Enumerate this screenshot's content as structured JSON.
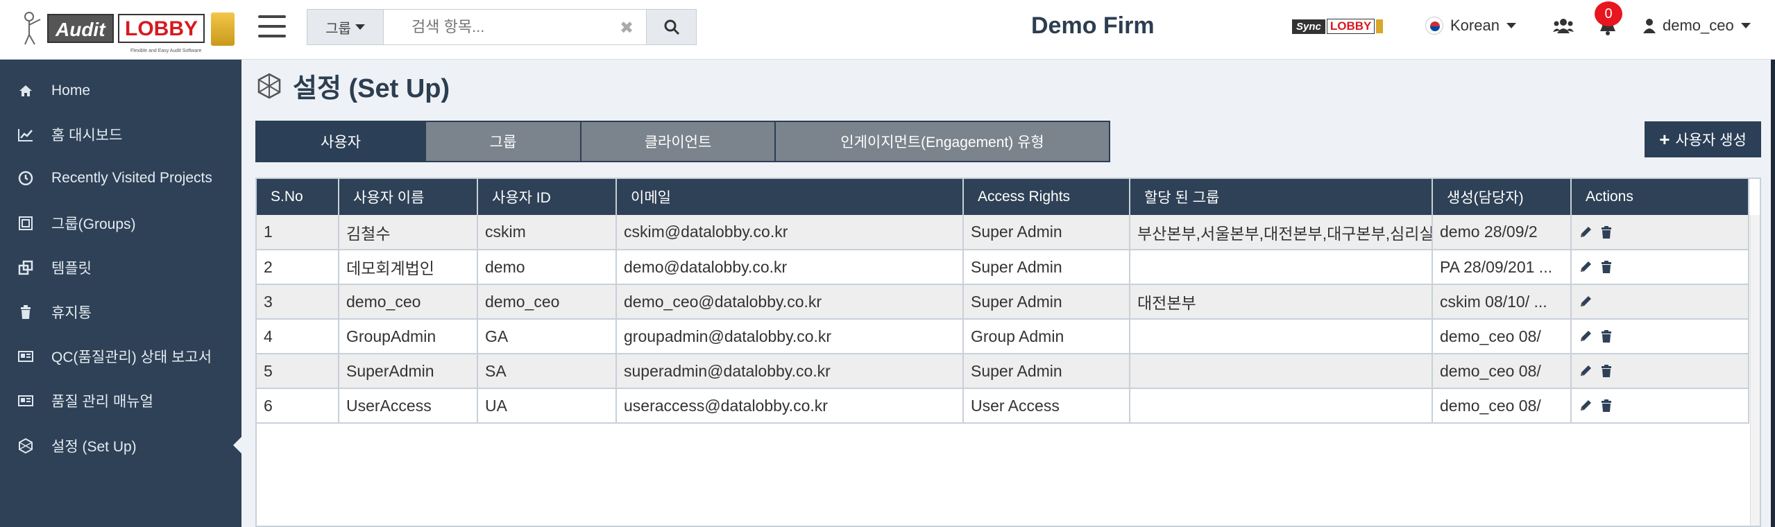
{
  "brand": {
    "logo_left": "Audit",
    "logo_right": "LOBBY",
    "tagline": "Flexible and Easy Audit Software",
    "sync_left": "Sync",
    "sync_right": "LOBBY"
  },
  "search": {
    "scope_label": "그룹",
    "placeholder": "검색 항목..."
  },
  "header": {
    "firm_name": "Demo Firm",
    "language": "Korean",
    "notification_count": "0",
    "username": "demo_ceo"
  },
  "sidebar": {
    "items": [
      {
        "label": "Home",
        "icon": "home-icon"
      },
      {
        "label": "홈 대시보드",
        "icon": "line-chart-icon"
      },
      {
        "label": "Recently Visited Projects",
        "icon": "clock-icon"
      },
      {
        "label": "그룹(Groups)",
        "icon": "groups-icon"
      },
      {
        "label": "템플릿",
        "icon": "template-icon"
      },
      {
        "label": "휴지통",
        "icon": "trash-icon"
      },
      {
        "label": "QC(품질관리) 상태 보고서",
        "icon": "report-icon"
      },
      {
        "label": "품질 관리 매뉴얼",
        "icon": "manual-icon"
      },
      {
        "label": "설정 (Set Up)",
        "icon": "setup-icon"
      }
    ]
  },
  "page": {
    "title": "설정 (Set Up)"
  },
  "tabs": [
    {
      "label": "사용자"
    },
    {
      "label": "그룹"
    },
    {
      "label": "클라이언트"
    },
    {
      "label": "인게이지먼트(Engagement) 유형"
    }
  ],
  "actions": {
    "create_user": "사용자 생성"
  },
  "table": {
    "headers": [
      "S.No",
      "사용자 이름",
      "사용자 ID",
      "이메일",
      "Access Rights",
      "할당 된 그룹",
      "생성(담당자)",
      "Actions"
    ],
    "rows": [
      {
        "sno": "1",
        "name": "김철수",
        "id": "cskim",
        "email": "cskim@datalobby.co.kr",
        "rights": "Super Admin",
        "groups": "부산본부,서울본부,대전본부,대구본부,심리실",
        "created": "demo 28/09/2",
        "delete": true
      },
      {
        "sno": "2",
        "name": "데모회계법인",
        "id": "demo",
        "email": "demo@datalobby.co.kr",
        "rights": "Super Admin",
        "groups": "",
        "created": "PA 28/09/201 ...",
        "delete": true
      },
      {
        "sno": "3",
        "name": "demo_ceo",
        "id": "demo_ceo",
        "email": "demo_ceo@datalobby.co.kr",
        "rights": "Super Admin",
        "groups": "대전본부",
        "created": "cskim 08/10/ ...",
        "delete": false
      },
      {
        "sno": "4",
        "name": "GroupAdmin",
        "id": "GA",
        "email": "groupadmin@datalobby.co.kr",
        "rights": "Group Admin",
        "groups": "",
        "created": "demo_ceo 08/",
        "delete": true
      },
      {
        "sno": "5",
        "name": "SuperAdmin",
        "id": "SA",
        "email": "superadmin@datalobby.co.kr",
        "rights": "Super Admin",
        "groups": "",
        "created": "demo_ceo 08/",
        "delete": true
      },
      {
        "sno": "6",
        "name": "UserAccess",
        "id": "UA",
        "email": "useraccess@datalobby.co.kr",
        "rights": "User Access",
        "groups": "",
        "created": "demo_ceo 08/",
        "delete": true
      }
    ]
  },
  "colors": {
    "sidebar_bg": "#2e4157",
    "header_row_bg": "#2e4157",
    "tab_inactive": "#7b838c",
    "badge": "#e8161e",
    "brand_red": "#d71920"
  }
}
